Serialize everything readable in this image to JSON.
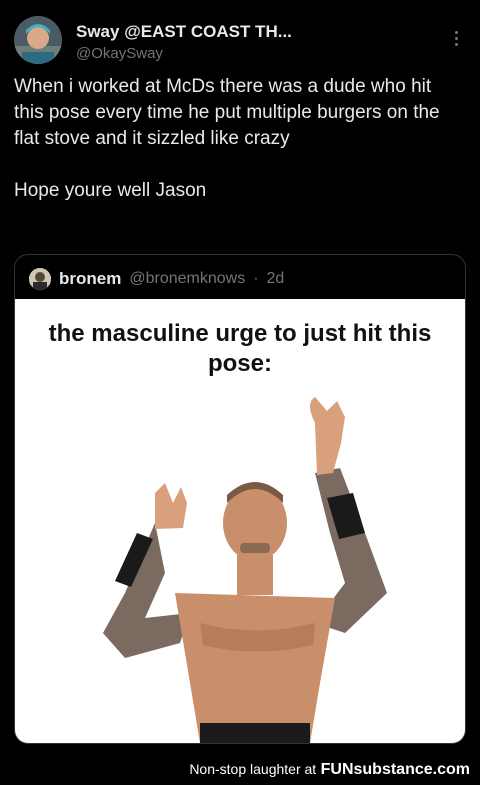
{
  "tweet": {
    "display_name": "Sway @EAST COAST TH...",
    "handle": "@OkaySway",
    "body": [
      "When i worked at McDs there was a dude who hit this pose every time he put multiple burgers on the flat stove and it sizzled like crazy",
      "Hope youre well Jason"
    ]
  },
  "quoted": {
    "name": "bronem",
    "handle": "@bronemknows",
    "time": "2d",
    "separator": "·",
    "caption": "the masculine urge to just hit this pose:"
  },
  "watermark": {
    "text": "Non-stop laughter at",
    "brand": "FUNsubstance.com"
  },
  "colors": {
    "background": "#000000",
    "text": "#e7e9ea",
    "secondary": "#71767b",
    "border": "#2f3336"
  },
  "icons": [
    "more-options-icon"
  ]
}
